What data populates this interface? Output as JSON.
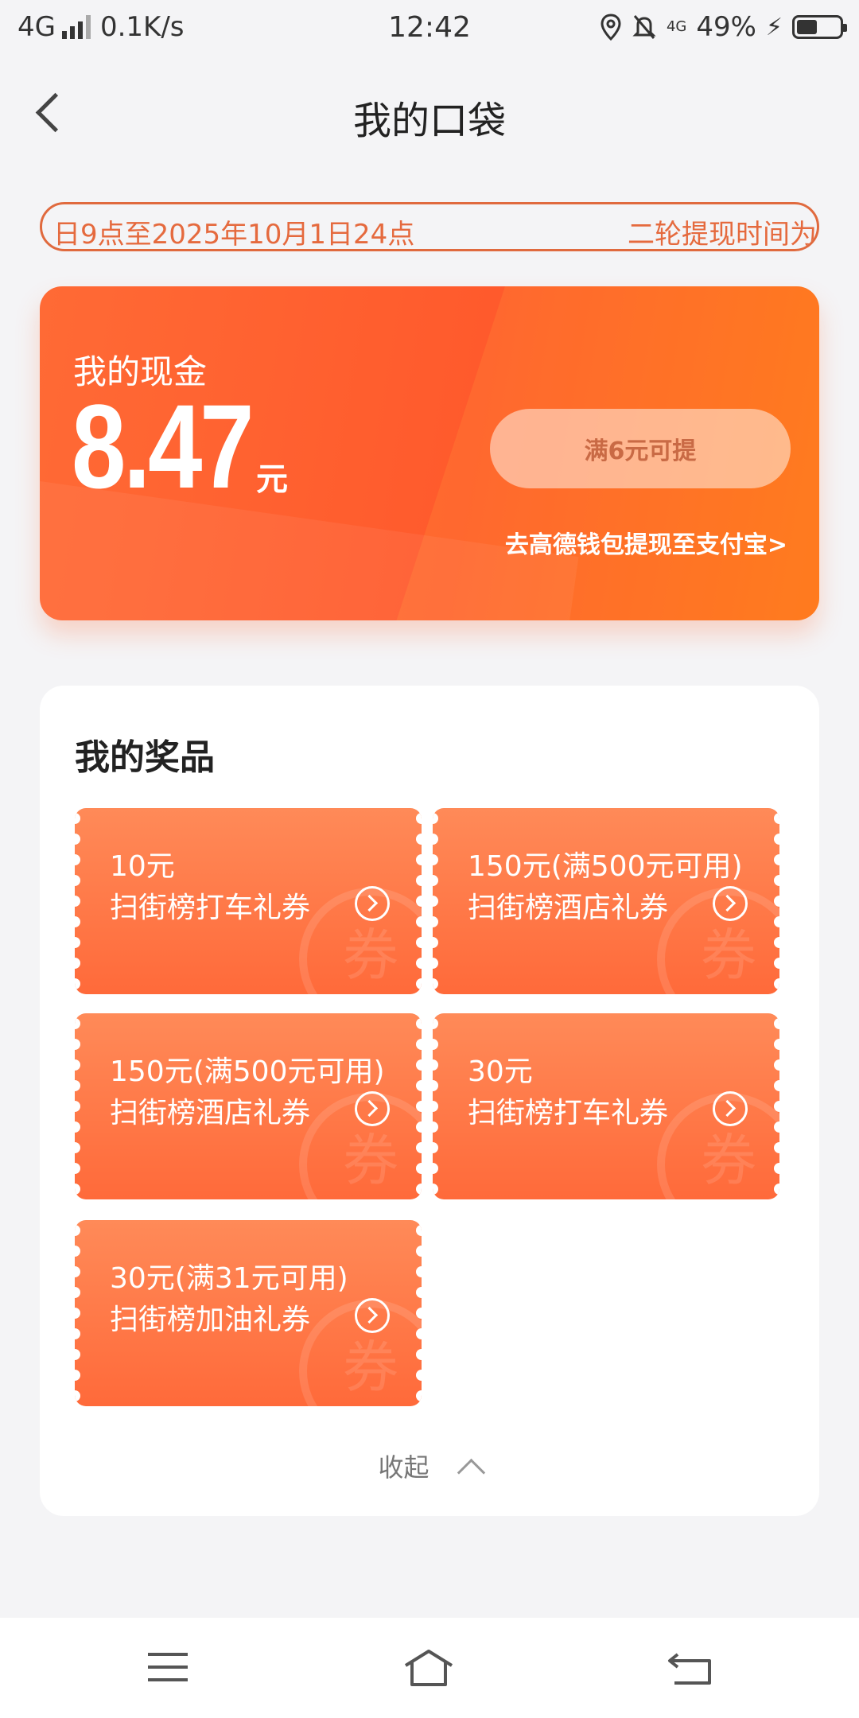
{
  "status_bar": {
    "network": "4G",
    "speed": "0.1K/s",
    "time": "12:42",
    "data_badge": "4G",
    "battery_text": "49%",
    "battery_level": 0.49
  },
  "header": {
    "title": "我的口袋"
  },
  "notice": {
    "segment_a": "日9点至2025年10月1日24点",
    "segment_b": "二轮提现时间为"
  },
  "cash": {
    "label": "我的现金",
    "amount": "8.47",
    "unit": "元",
    "withdraw_button": "满6元可提",
    "wallet_link": "去高德钱包提现至支付宝>"
  },
  "prizes": {
    "title": "我的奖品",
    "coupons": [
      {
        "value": "10元",
        "name": "扫街榜打车礼券"
      },
      {
        "value": "150元(满500元可用)",
        "name": "扫街榜酒店礼券"
      },
      {
        "value": "150元(满500元可用)",
        "name": "扫街榜酒店礼券"
      },
      {
        "value": "30元",
        "name": "扫街榜打车礼券"
      },
      {
        "value": "30元(满31元可用)",
        "name": "扫街榜加油礼券"
      }
    ],
    "stamp_char": "券",
    "collapse_label": "收起"
  },
  "colors": {
    "accent": "#ff6a35",
    "notice_border": "#e06a3e",
    "background": "#f4f4f6"
  }
}
